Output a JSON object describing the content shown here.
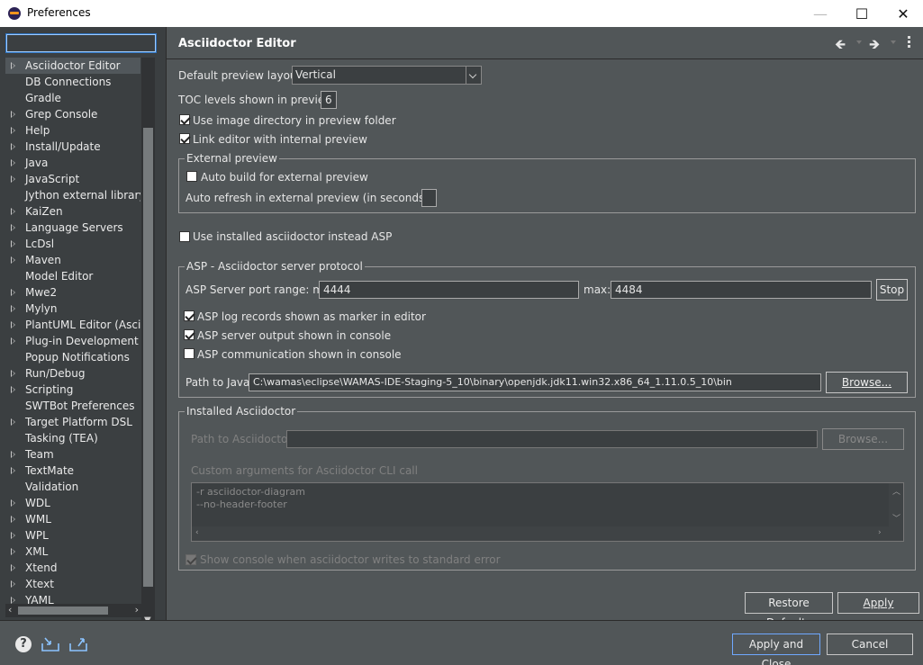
{
  "window": {
    "title": "Preferences"
  },
  "filter": {
    "value": ""
  },
  "tree": [
    {
      "label": "Asciidoctor Editor",
      "expandable": true,
      "selected": true
    },
    {
      "label": "DB Connections",
      "expandable": false
    },
    {
      "label": "Gradle",
      "expandable": false
    },
    {
      "label": "Grep Console",
      "expandable": true
    },
    {
      "label": "Help",
      "expandable": true
    },
    {
      "label": "Install/Update",
      "expandable": true
    },
    {
      "label": "Java",
      "expandable": true
    },
    {
      "label": "JavaScript",
      "expandable": true
    },
    {
      "label": "Jython external library",
      "expandable": false
    },
    {
      "label": "KaiZen",
      "expandable": true
    },
    {
      "label": "Language Servers",
      "expandable": true
    },
    {
      "label": "LcDsl",
      "expandable": true
    },
    {
      "label": "Maven",
      "expandable": true
    },
    {
      "label": "Model Editor",
      "expandable": false
    },
    {
      "label": "Mwe2",
      "expandable": true
    },
    {
      "label": "Mylyn",
      "expandable": true
    },
    {
      "label": "PlantUML Editor (Asciidoctor)",
      "expandable": true
    },
    {
      "label": "Plug-in Development",
      "expandable": true
    },
    {
      "label": "Popup Notifications",
      "expandable": false
    },
    {
      "label": "Run/Debug",
      "expandable": true
    },
    {
      "label": "Scripting",
      "expandable": true
    },
    {
      "label": "SWTBot Preferences",
      "expandable": false
    },
    {
      "label": "Target Platform DSL",
      "expandable": true
    },
    {
      "label": "Tasking (TEA)",
      "expandable": false
    },
    {
      "label": "Team",
      "expandable": true
    },
    {
      "label": "TextMate",
      "expandable": true
    },
    {
      "label": "Validation",
      "expandable": false
    },
    {
      "label": "WDL",
      "expandable": true
    },
    {
      "label": "WML",
      "expandable": true
    },
    {
      "label": "WPL",
      "expandable": true
    },
    {
      "label": "XML",
      "expandable": true
    },
    {
      "label": "Xtend",
      "expandable": true
    },
    {
      "label": "Xtext",
      "expandable": true
    },
    {
      "label": "YAML",
      "expandable": true
    }
  ],
  "page": {
    "title": "Asciidoctor Editor",
    "default_preview_layout_label": "Default preview layout",
    "default_preview_layout_value": "Vertical",
    "toc_levels_label": "TOC levels shown in preview",
    "toc_levels_value": "6",
    "use_image_dir_label": "Use image directory in preview folder",
    "link_editor_label": "Link editor with internal preview",
    "external_preview": {
      "title": "External preview",
      "auto_build_label": "Auto build for external preview",
      "auto_refresh_label": "Auto refresh in external preview (in seconds)",
      "auto_refresh_value": ""
    },
    "use_installed_label": "Use installed asciidoctor instead ASP",
    "asp": {
      "title": "ASP - Asciidoctor server protocol",
      "port_min_label": "ASP Server port range: min",
      "port_min_value": "4444",
      "port_max_label": "max:",
      "port_max_value": "4484",
      "stop_label": "Stop",
      "log_records_label": "ASP log records shown as marker in editor",
      "server_output_label": "ASP server output shown in console",
      "communication_label": "ASP communication shown in console",
      "path_java_label": "Path to Java",
      "path_java_value": "C:\\wamas\\eclipse\\WAMAS-IDE-Staging-5_10\\binary\\openjdk.jdk11.win32.x86_64_1.11.0.5_10\\bin",
      "browse_label": "Browse..."
    },
    "installed": {
      "title": "Installed Asciidoctor",
      "path_label": "Path to Asciidoctor",
      "path_value": "",
      "browse_label": "Browse...",
      "custom_args_label": "Custom arguments for Asciidoctor CLI call",
      "custom_args_line1": "-r asciidoctor-diagram",
      "custom_args_line2": "--no-header-footer",
      "show_console_label": "Show console when asciidoctor writes to standard error"
    },
    "restore_defaults_label": "Restore Defaults",
    "apply_label": "Apply"
  },
  "footer": {
    "apply_close_label": "Apply and Close",
    "cancel_label": "Cancel"
  },
  "icons": {
    "app": "eclipse-icon",
    "help": "help-icon",
    "import": "import-icon",
    "export": "export-icon",
    "back": "back-arrow-icon",
    "forward": "forward-arrow-icon"
  }
}
